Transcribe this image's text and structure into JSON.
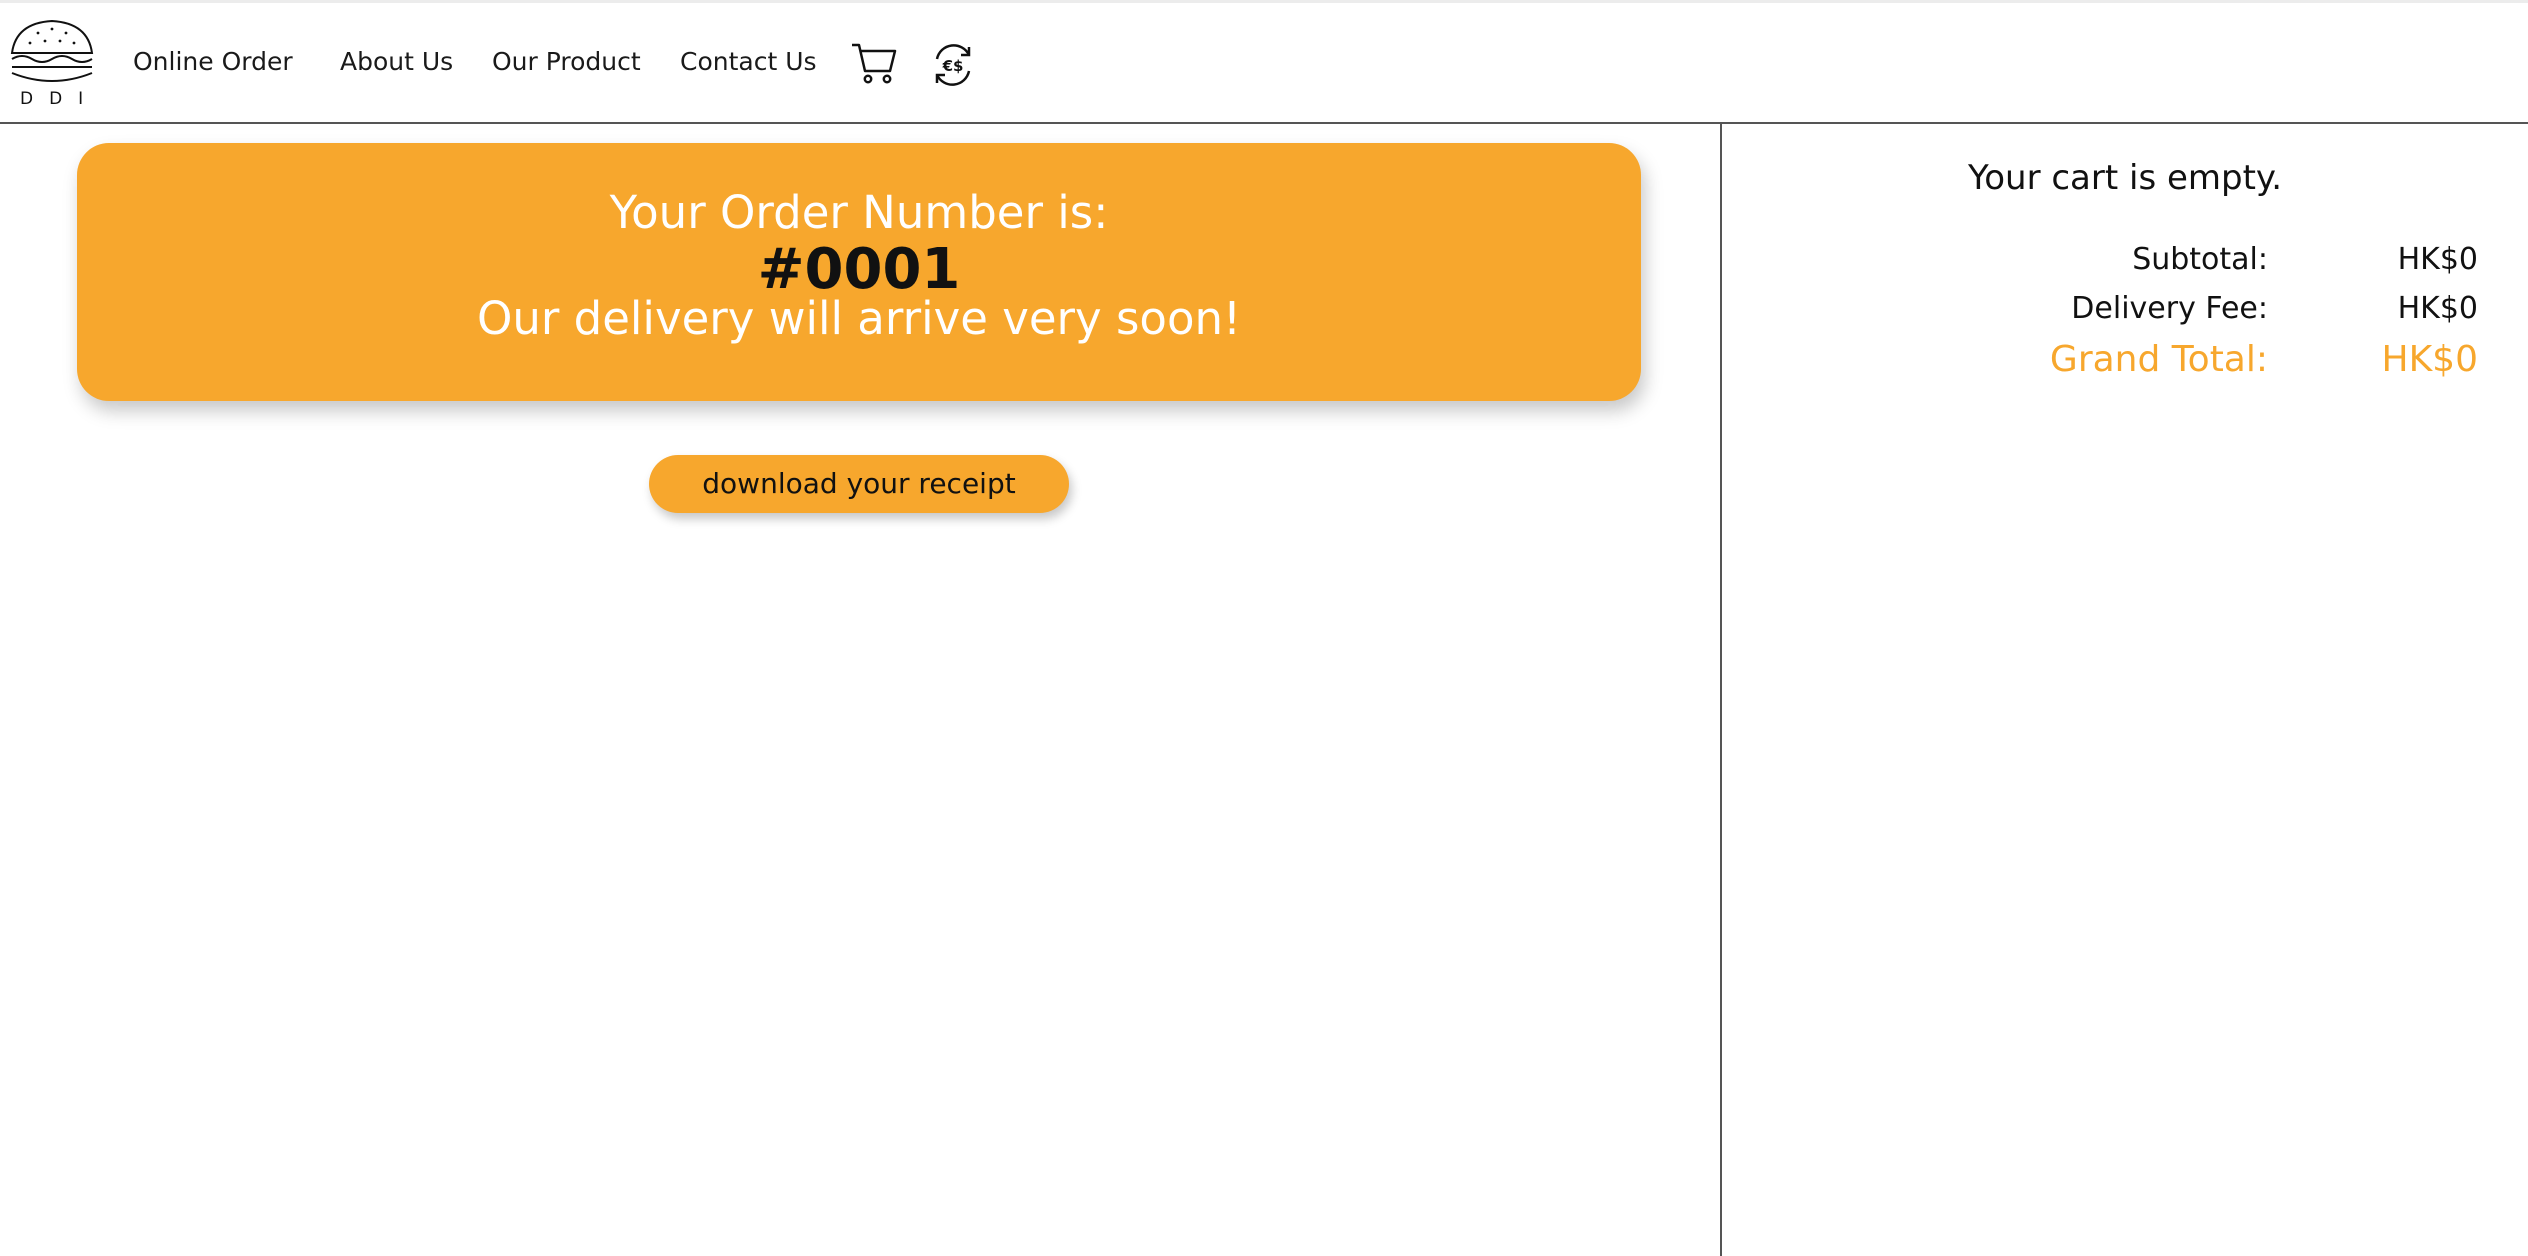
{
  "brand": {
    "logo_text": "DDI",
    "logo_icon": "burger-icon"
  },
  "nav": {
    "links": [
      "Online Order",
      "About Us",
      "Our Product",
      "Contact Us"
    ],
    "cart_icon": "cart-icon",
    "currency_icon": "currency-exchange-icon"
  },
  "order": {
    "heading": "Your Order Number is:",
    "number": "#0001",
    "message": "Our delivery will arrive very soon!",
    "receipt_button": "download your receipt"
  },
  "cart": {
    "empty_text": "Your cart is empty.",
    "subtotal_label": "Subtotal:",
    "subtotal_value": "HK$0",
    "delivery_label": "Delivery Fee:",
    "delivery_value": "HK$0",
    "grand_label": "Grand Total:",
    "grand_value": "HK$0"
  },
  "colors": {
    "accent": "#f7a72d",
    "text": "#111111",
    "divider": "#555555"
  }
}
